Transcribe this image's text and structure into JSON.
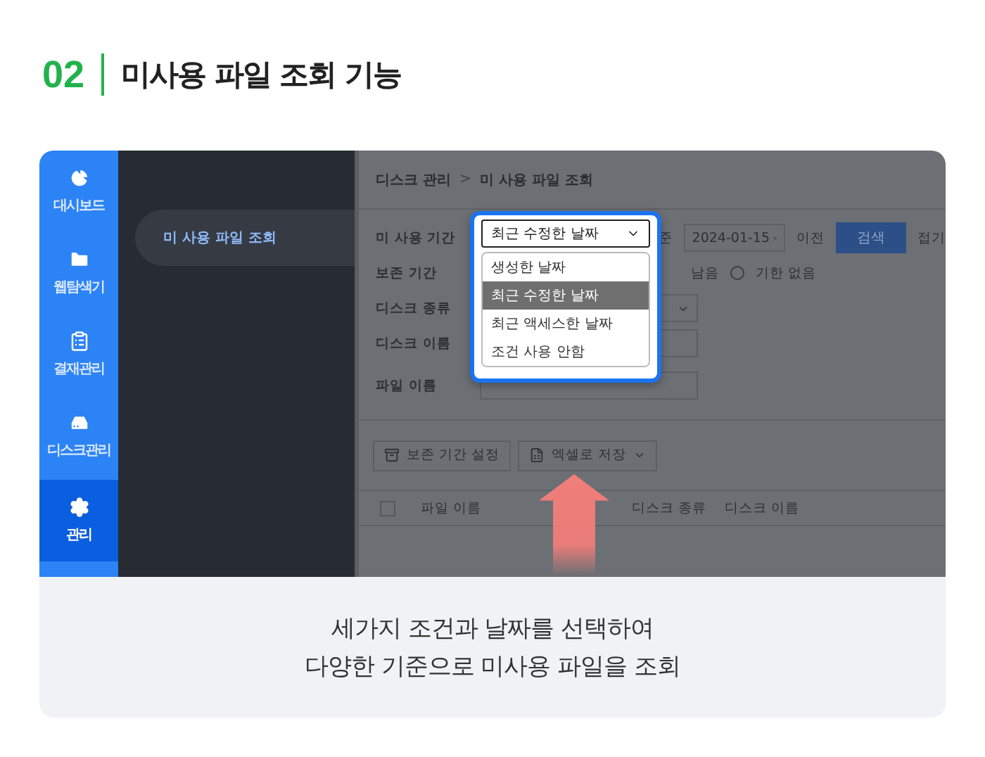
{
  "header": {
    "number": "02",
    "title": "미사용 파일 조회 기능"
  },
  "sidebar": {
    "items": [
      {
        "label": "대시보드",
        "kind": "pie",
        "selected": false
      },
      {
        "label": "웹탐색기",
        "kind": "folder",
        "selected": false
      },
      {
        "label": "결재관리",
        "kind": "clipboard",
        "selected": false
      },
      {
        "label": "디스크관리",
        "kind": "drive",
        "selected": false
      },
      {
        "label": "관리",
        "kind": "gear",
        "selected": true
      }
    ]
  },
  "subnav": {
    "items": [
      {
        "label": "미 사용 파일 조회",
        "selected": true
      }
    ]
  },
  "breadcrumb": {
    "items": [
      "디스크 관리",
      "미 사용 파일 조회"
    ],
    "separator": ">"
  },
  "filters": {
    "period": {
      "label": "미 사용 기간",
      "value": "최근 수정한 날짜",
      "basis": "준",
      "date": "2024-01-15",
      "before": "이전",
      "search": "검색",
      "collapse": "접기"
    },
    "retention": {
      "label": "보존 기간",
      "remaining": "남음",
      "options": [
        {
          "label": "기한 없음",
          "selected": false
        }
      ]
    },
    "disk_type": {
      "label": "디스크 종류"
    },
    "disk_name": {
      "label": "디스크 이름"
    },
    "file_name": {
      "label": "파일 이름"
    }
  },
  "dropdown": {
    "options": [
      {
        "label": "생성한 날짜",
        "selected": false
      },
      {
        "label": "최근 수정한 날짜",
        "selected": true
      },
      {
        "label": "최근 액세스한 날짜",
        "selected": false
      },
      {
        "label": "조건 사용 안함",
        "selected": false
      }
    ]
  },
  "toolbar": {
    "buttons": [
      {
        "label": "보존 기간 설정",
        "kind": "archive"
      },
      {
        "label": "엑셀로 저장",
        "kind": "excel"
      }
    ]
  },
  "table": {
    "select_all": {
      "checked": false
    },
    "columns": [
      "파일 이름",
      "디스크 종류",
      "디스크 이름"
    ]
  },
  "caption": {
    "lines": [
      "세가지 조건과 날짜를 선택하여",
      "다양한 기준으로 미사용 파일을 조회"
    ]
  }
}
